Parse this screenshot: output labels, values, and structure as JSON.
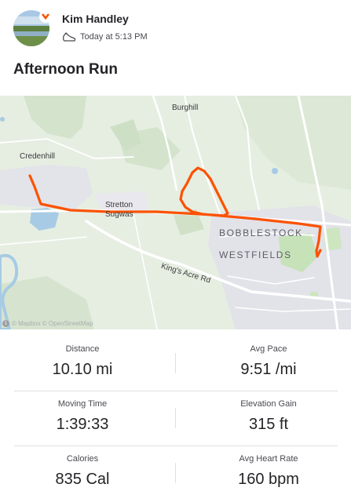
{
  "athlete": {
    "name": "Kim Handley",
    "timestamp": "Today at 5:13 PM",
    "activity_icon": "running-shoe-icon"
  },
  "activity": {
    "title": "Afternoon Run"
  },
  "map": {
    "labels": {
      "burghill": "Burghill",
      "credenhill": "Credenhill",
      "stretton_line1": "Stretton",
      "stretton_line2": "Sugwas",
      "bobblestock": "BOBBLESTOCK",
      "westfields": "WESTFIELDS",
      "kings_acre": "King's Acre Rd"
    },
    "attribution": "© Mapbox © OpenStreetMap",
    "route_color": "#fc5200"
  },
  "stats": [
    {
      "label": "Distance",
      "value": "10.10 mi"
    },
    {
      "label": "Avg Pace",
      "value": "9:51 /mi"
    },
    {
      "label": "Moving Time",
      "value": "1:39:33"
    },
    {
      "label": "Elevation Gain",
      "value": "315 ft"
    },
    {
      "label": "Calories",
      "value": "835 Cal"
    },
    {
      "label": "Avg Heart Rate",
      "value": "160 bpm"
    }
  ]
}
